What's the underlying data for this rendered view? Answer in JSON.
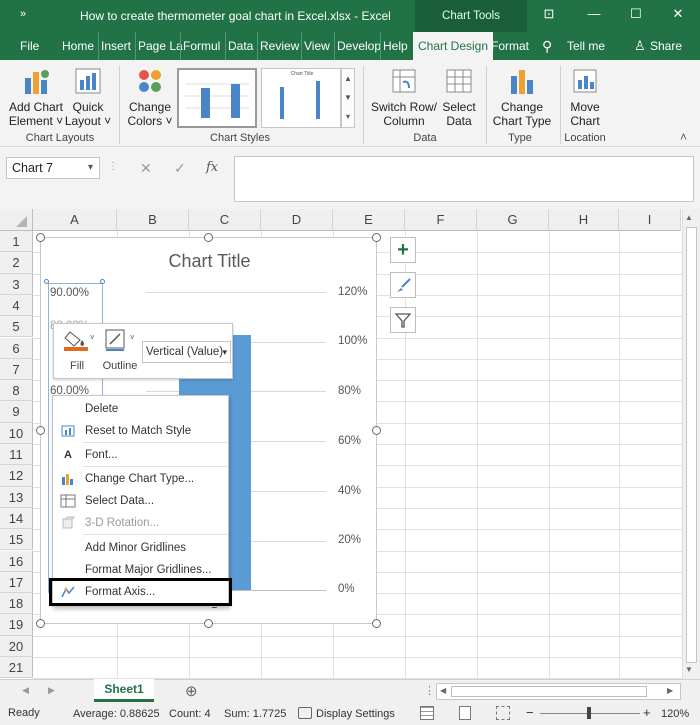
{
  "titlebar": {
    "qa_icon": "»",
    "title": "How to create thermometer goal chart in Excel.xlsx  -  Excel",
    "context_group": "Chart Tools",
    "buttons": {
      "ribbon_display": "⊡",
      "minimize": "—",
      "maximize": "☐",
      "close": "✕"
    }
  },
  "tabs": [
    "File",
    "Home",
    "Insert",
    "Page La",
    "Formul",
    "Data",
    "Review",
    "View",
    "Develop",
    "Help",
    "Chart Design",
    "Format",
    "Tell me",
    "Share"
  ],
  "tell_icon": "lightbulb-icon",
  "share_icon": "person-icon",
  "ribbon": {
    "add_chart_element": [
      "Add Chart",
      "Element ˅"
    ],
    "quick_layout": [
      "Quick",
      "Layout ˅"
    ],
    "change_colors": [
      "Change",
      "Colors ˅"
    ],
    "switch_row_col": [
      "Switch Row/",
      "Column"
    ],
    "select_data": [
      "Select",
      "Data"
    ],
    "change_chart_type": [
      "Change",
      "Chart Type"
    ],
    "move_chart": [
      "Move",
      "Chart"
    ],
    "groups": {
      "chart_layouts": "Chart Layouts",
      "chart_styles": "Chart Styles",
      "data": "Data",
      "type": "Type",
      "location": "Location"
    },
    "style_thumb_title": "Chart Title",
    "collapse": "˄"
  },
  "formula_bar": {
    "name_box": "Chart 7",
    "dropdown": "▾",
    "cancel": "✕",
    "enter": "✓",
    "fx": "fx",
    "value": ""
  },
  "grid": {
    "columns": [
      "A",
      "B",
      "C",
      "D",
      "E",
      "F",
      "G",
      "H",
      "I"
    ],
    "rows": [
      "1",
      "2",
      "3",
      "4",
      "5",
      "6",
      "7",
      "8",
      "9",
      "10",
      "11",
      "12",
      "13",
      "14",
      "15",
      "16",
      "17",
      "18",
      "19",
      "20",
      "21"
    ]
  },
  "chart": {
    "title": "Chart Title",
    "left_axis_visible": [
      "90.00%",
      "60.00%"
    ],
    "left_axis_partial": [
      "80.00%"
    ],
    "right_axis": [
      "120%",
      "100%",
      "80%",
      "60%",
      "40%",
      "20%",
      "0%"
    ],
    "x_label": "1",
    "bar_color": "#5b9bd5"
  },
  "side_buttons": {
    "elements": "+",
    "styles": "brush-icon",
    "filters": "filter-icon"
  },
  "mini_toolbar": {
    "fill": "Fill",
    "outline": "Outline",
    "element": "Vertical (Value)",
    "dropdown": "▾"
  },
  "context_menu": [
    {
      "label": "Delete",
      "icon": "",
      "disabled": false
    },
    {
      "label": "Reset to Match Style",
      "icon": "reset-style-icon",
      "disabled": false
    },
    {
      "label": "Font...",
      "icon": "font-icon",
      "disabled": false
    },
    {
      "label": "Change Chart Type...",
      "icon": "chart-type-icon",
      "disabled": false
    },
    {
      "label": "Select Data...",
      "icon": "select-data-icon",
      "disabled": false
    },
    {
      "label": "3-D Rotation...",
      "icon": "rotation-icon",
      "disabled": true
    },
    {
      "label": "Add Minor Gridlines",
      "icon": "",
      "disabled": false
    },
    {
      "label": "Format Major Gridlines...",
      "icon": "",
      "disabled": false
    },
    {
      "label": "Format Axis...",
      "icon": "format-axis-icon",
      "disabled": false
    }
  ],
  "sheetbar": {
    "sheet": "Sheet1",
    "prev": "◀",
    "next": "▶",
    "add": "⊕",
    "more": "⋮"
  },
  "status": {
    "ready": "Ready",
    "average": "Average: 0.88625",
    "count": "Count: 4",
    "sum": "Sum: 1.7725",
    "display_settings": "Display Settings",
    "zoom": "120%",
    "zoom_minus": "−",
    "zoom_plus": "+"
  },
  "colors": {
    "excel_green": "#217346",
    "highlight_box": "#000000"
  }
}
